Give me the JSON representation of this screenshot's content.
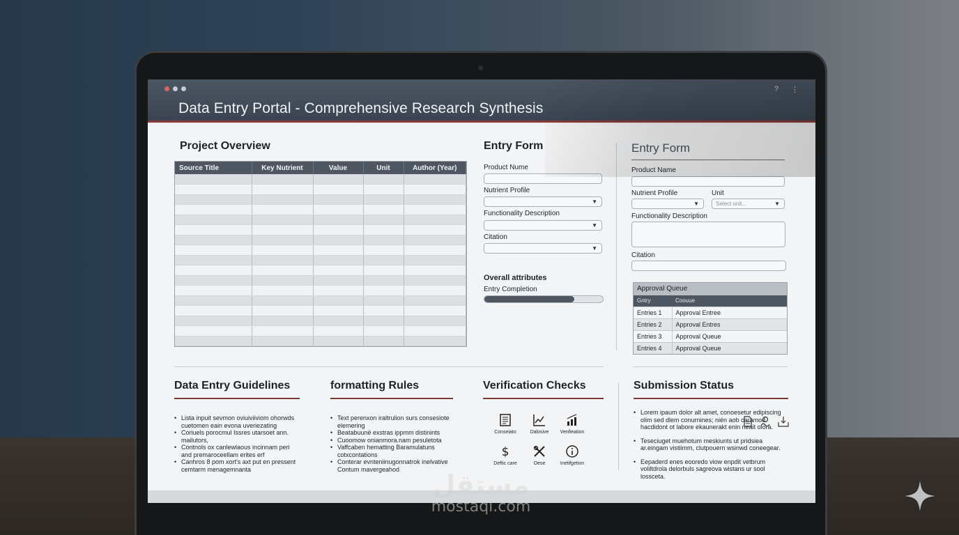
{
  "window": {
    "title": "Data Entry Portal - Comprehensive Research Synthesis",
    "help_icon": "question-icon",
    "menu_icon": "kebab-menu-icon"
  },
  "project_overview": {
    "heading": "Project Overview",
    "columns": [
      "Source Title",
      "Key Nutrient",
      "Value",
      "Unit",
      "Author (Year)"
    ],
    "empty_rows": 17
  },
  "entry_form_left": {
    "heading": "Entry Form",
    "product_name_label": "Product Nume",
    "nutrient_profile_label": "Nutrient Profile",
    "functionality_label": "Functionality Description",
    "citation_label": "Citation",
    "overall_attributes_heading": "Overall attributes",
    "entry_completion_label": "Entry Completion",
    "entry_completion_fraction": 0.76
  },
  "entry_form_right": {
    "heading": "Entry Form",
    "product_name_label": "Product Name",
    "nutrient_profile_label": "Nutrient Profile",
    "unit_label": "Unit",
    "unit_placeholder": "Select unit...",
    "functionality_label": "Functionality Description",
    "citation_label": "Citation"
  },
  "approval_queue": {
    "title": "Approval Queue",
    "columns": [
      "Gntry",
      "Coouue"
    ],
    "rows": [
      [
        "Entries 1",
        "Approval Entree"
      ],
      [
        "Entries 2",
        "Approval Entres"
      ],
      [
        "Entries 3",
        "Approval Queue"
      ],
      [
        "Entries 4",
        "Approval Queue"
      ]
    ]
  },
  "guidelines": {
    "heading": "Data Entry Guidelines",
    "items": [
      "Lista inpuit sevmon oviuiviiviom ohorwds cuetomen eain evona uveriezating",
      "Coriuels porocmul Issres utarsoet ann. mailutors,",
      "Contnols ox canlewlaous incinnam peri and premaroceellam erites erf",
      "Canhros 8 pom xort's axt put en pressent cemtarm menagemnanta"
    ]
  },
  "formatting_rules": {
    "heading": "formatting Rules",
    "items": [
      "Text perenxon iraltrulion surs consesiote elemering",
      "Beatabuuné exstras ippmm distinints",
      "Cuoomow onianmora.nam pesuletota",
      "Vaffcaben hematting Baramulatuns cotxcontations",
      "Conterar evnteniinugonnatrok inelvative Contum mavergeahod"
    ]
  },
  "verification_checks": {
    "heading": "Verification Checks",
    "items": [
      {
        "label": "Conseiato",
        "icon": "document-icon"
      },
      {
        "label": "Dalosive",
        "icon": "line-chart-icon"
      },
      {
        "label": "Venfieation",
        "icon": "bar-chart-icon"
      },
      {
        "label": "Deftic care",
        "icon": "dollar-icon"
      },
      {
        "label": "Oese",
        "icon": "tools-icon"
      },
      {
        "label": "Inetifgetion",
        "icon": "info-icon"
      }
    ]
  },
  "submission_status": {
    "heading": "Submission Status",
    "icons": [
      "document-icon",
      "signature-icon",
      "inbox-download-icon"
    ],
    "items": [
      "Lorem ipaum dolor alt amet, conoesetur edipiscing olim sed dlem conurnines; nién aob caramod hacdidont ot labore ekaunerakt enin neait olora.",
      "Teseciuget muehotum meskiunts ut pridsiea ar.eingam vistiimm, clutpouern wsinwd coneegear.",
      "Eepaderd enes eooredo viow enpdit vetbrum voliltdrola delorbuls sagreova wistans ur sool lossceta."
    ]
  },
  "watermark": {
    "arabic": "مستقل",
    "latin": "mostaql.com"
  },
  "colors": {
    "header": "#3f4955",
    "accent_rule": "#7a3b37",
    "table_header": "#4d5661",
    "background": "#f3f4f5"
  }
}
